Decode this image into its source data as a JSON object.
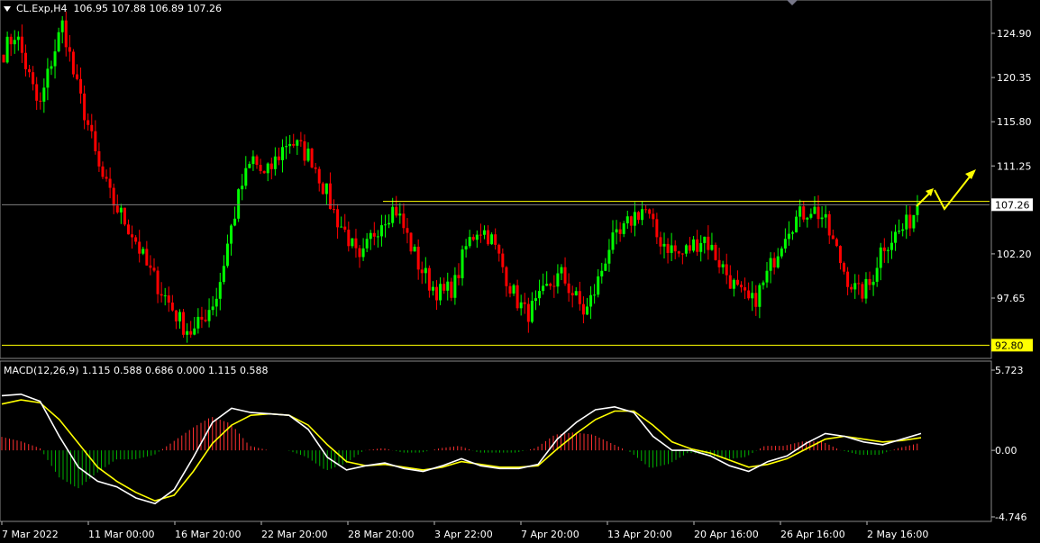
{
  "symbol": "CL.Exp,H4",
  "ohlc": {
    "open": "106.95",
    "high": "107.88",
    "low": "106.89",
    "close": "107.26"
  },
  "macd_label": "MACD(12,26,9) 1.115 0.588 0.686 0.000 1.115 0.588",
  "colors": {
    "background": "#000000",
    "bull": "#00ff00",
    "bear": "#ff0000",
    "macd_line": "#ffffff",
    "signal_line": "#ffff00",
    "level_line": "#ffff00",
    "bid_line": "#7f7f7f",
    "hist_up": "#ff3030",
    "hist_down": "#00b000"
  },
  "chart_data": [
    {
      "type": "candlestick",
      "ylim": [
        89.9,
        127.0
      ],
      "y_ticks": [
        "124.90",
        "120.35",
        "115.80",
        "111.25",
        "107.26",
        "102.20",
        "97.65"
      ],
      "levels": [
        {
          "value": 107.26,
          "label": "107.26",
          "style": "current-price"
        },
        {
          "value": 92.8,
          "label": "92.80",
          "style": "support"
        },
        {
          "value": 107.6,
          "label": "",
          "style": "resistance"
        }
      ],
      "x_ticks": [
        "7 Mar 2022",
        "11 Mar 00:00",
        "16 Mar 20:00",
        "22 Mar 20:00",
        "28 Mar 20:00",
        "3 Apr 22:00",
        "7 Apr 20:00",
        "13 Apr 20:00",
        "20 Apr 16:00",
        "26 Apr 16:00",
        "2 May 16:00"
      ],
      "close_path": [
        123,
        125,
        121,
        117,
        122,
        126,
        120,
        116,
        111,
        108,
        106,
        104,
        101,
        99,
        97,
        95,
        94,
        96,
        98,
        104,
        109,
        112,
        110,
        112,
        114,
        113,
        112,
        109,
        106,
        104,
        101,
        104,
        106,
        107,
        104,
        101,
        99,
        98,
        99,
        103,
        105,
        104,
        101,
        98,
        96,
        97,
        99,
        100,
        98,
        96,
        99,
        103,
        104,
        106,
        107,
        104,
        103,
        102,
        103,
        104,
        102,
        100,
        98,
        97,
        99,
        102,
        105,
        106,
        107,
        106,
        103,
        100,
        98,
        99,
        103,
        104,
        105,
        107
      ]
    },
    {
      "type": "macd",
      "ylim": [
        -4.746,
        5.723
      ],
      "y_ticks": [
        "5.723",
        "0.00",
        "-4.746"
      ],
      "macd": [
        3.9,
        4.0,
        3.5,
        1.0,
        -1.2,
        -2.2,
        -2.6,
        -3.4,
        -3.8,
        -2.8,
        -0.5,
        2.0,
        3.0,
        2.7,
        2.6,
        2.5,
        1.5,
        -0.5,
        -1.4,
        -1.1,
        -0.9,
        -1.3,
        -1.5,
        -1.1,
        -0.6,
        -1.1,
        -1.3,
        -1.3,
        -1.0,
        0.8,
        2.0,
        2.9,
        3.1,
        2.7,
        1.0,
        0.0,
        0.0,
        -0.4,
        -1.1,
        -1.5,
        -0.8,
        -0.4,
        0.5,
        1.2,
        1.0,
        0.6,
        0.4,
        0.8,
        1.2
      ],
      "signal": [
        3.3,
        3.6,
        3.4,
        2.2,
        0.5,
        -1.2,
        -2.2,
        -3.0,
        -3.6,
        -3.2,
        -1.5,
        0.5,
        1.8,
        2.5,
        2.6,
        2.5,
        1.8,
        0.4,
        -0.8,
        -1.1,
        -1.0,
        -1.2,
        -1.4,
        -1.2,
        -0.8,
        -1.0,
        -1.2,
        -1.2,
        -1.1,
        0.1,
        1.2,
        2.2,
        2.8,
        2.8,
        1.8,
        0.6,
        0.1,
        -0.2,
        -0.7,
        -1.2,
        -1.0,
        -0.6,
        0.1,
        0.8,
        1.0,
        0.8,
        0.6,
        0.7,
        0.9
      ]
    }
  ],
  "annotation": {
    "type": "forecast-arrow",
    "color": "#ffff00"
  }
}
